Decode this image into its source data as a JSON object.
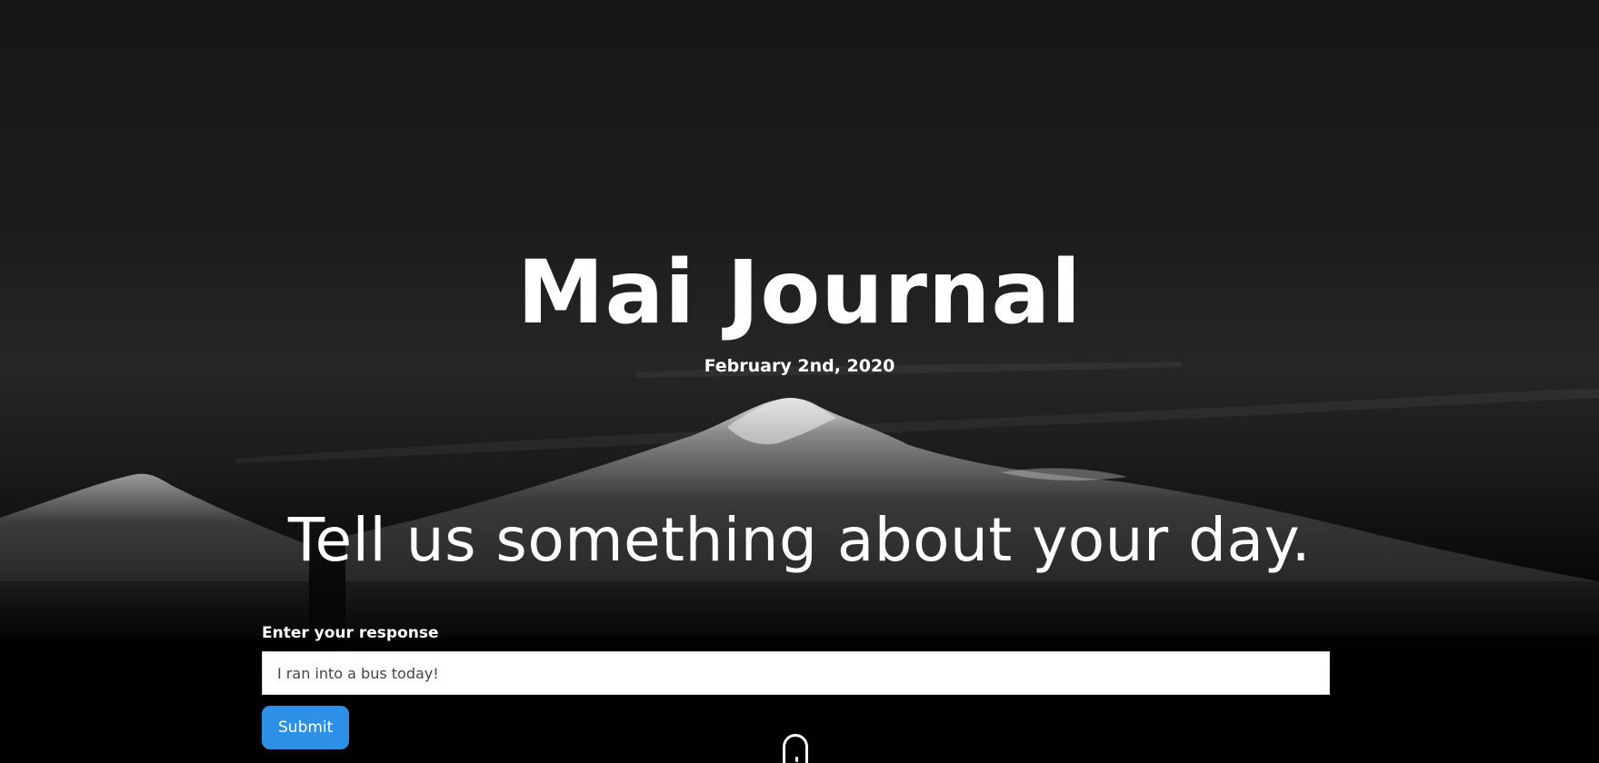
{
  "header": {
    "title": "Mai Journal",
    "date": "February 2nd, 2020"
  },
  "main": {
    "prompt": "Tell us something about your day.",
    "form": {
      "label": "Enter your response",
      "input_value": "I ran into a bus today!",
      "submit_label": "Submit"
    }
  },
  "icons": {
    "scroll_indicator": "mouse-scroll-icon"
  },
  "colors": {
    "accent": "#2e8fe6",
    "background": "#000000",
    "text": "#ffffff"
  }
}
